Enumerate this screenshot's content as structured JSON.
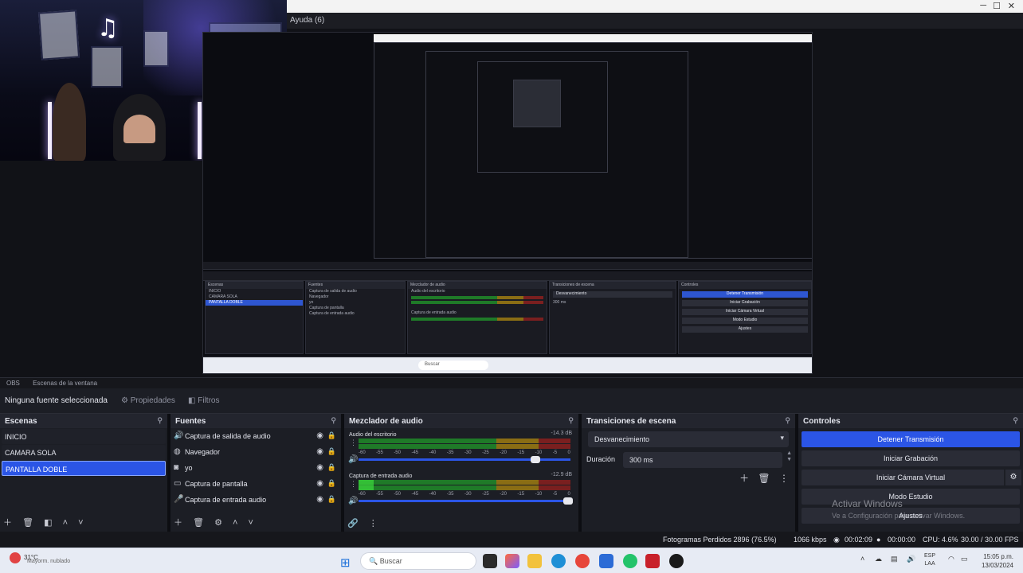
{
  "help_window": {
    "title": "Ayuda (6)"
  },
  "mode_bar": {
    "items": [
      "OBS",
      "Escenas de la ventana"
    ]
  },
  "source_toolbar": {
    "no_source": "Ninguna fuente seleccionada",
    "properties": "Propiedades",
    "filters": "Filtros"
  },
  "scenes_dock": {
    "title": "Escenas",
    "items": [
      "INICIO",
      "CAMARA SOLA",
      "PANTALLA DOBLE"
    ],
    "selected_index": 2
  },
  "sources_dock": {
    "title": "Fuentes",
    "items": [
      "Captura de salida de audio",
      "Navegador",
      "yo",
      "Captura de pantalla",
      "Captura de entrada audio"
    ]
  },
  "mixer_dock": {
    "title": "Mezclador de audio",
    "ticks": [
      "-60",
      "-55",
      "-50",
      "-45",
      "-40",
      "-35",
      "-30",
      "-25",
      "-20",
      "-15",
      "-10",
      "-5",
      "0"
    ],
    "channels": [
      {
        "name": "Audio del escritorio",
        "db": "-14.3 dB",
        "level": 0.0,
        "volume": 0.83
      },
      {
        "name": "Captura de entrada audio",
        "db": "-12.9 dB",
        "level": 0.07,
        "volume": 0.98
      }
    ]
  },
  "transitions_dock": {
    "title": "Transiciones de escena",
    "transition": "Desvanecimiento",
    "duration_label": "Duración",
    "duration": "300 ms"
  },
  "controls_dock": {
    "title": "Controles",
    "buttons": [
      "Detener Transmisión",
      "Iniciar Grabación",
      "Iniciar Cámara Virtual",
      "Modo Estudio",
      "Ajustes"
    ],
    "watermark_title": "Activar Windows",
    "watermark_sub": "Ve a Configuración para activar Windows."
  },
  "status_bar": {
    "dropped": "Fotogramas Perdidos 2896 (76.5%)",
    "bitrate": "1066 kbps",
    "stream_time": "00:02:09",
    "rec_time": "00:00:00",
    "cpu": "CPU: 4.6%",
    "fps": "30.00 / 30.00 FPS"
  },
  "taskbar": {
    "weather_temp": "31°C",
    "weather_desc": "Mayorm. nublado",
    "search_placeholder": "Buscar",
    "lang_top": "ESP",
    "lang_bottom": "LAA",
    "time": "15:05 p.m.",
    "date": "13/03/2024"
  },
  "nested_preview": {
    "scenes": [
      "INICIO",
      "CAMARA SOLA",
      "PANTALLA DOBLE"
    ],
    "sources": [
      "Captura de salida de audio",
      "Navegador",
      "yo",
      "Captura de pantalla",
      "Captura de entrada audio"
    ],
    "controls": [
      "Detener Transmisión",
      "Iniciar Grabación",
      "Iniciar Cámara Virtual",
      "Modo Estudio",
      "Ajustes"
    ],
    "transition": "Desvanecimiento",
    "duration": "300 ms",
    "search": "Buscar"
  },
  "colors": {
    "accent": "#2b55e6",
    "panel": "#1c1e25",
    "header": "#23252e",
    "background": "#0c0d12"
  }
}
